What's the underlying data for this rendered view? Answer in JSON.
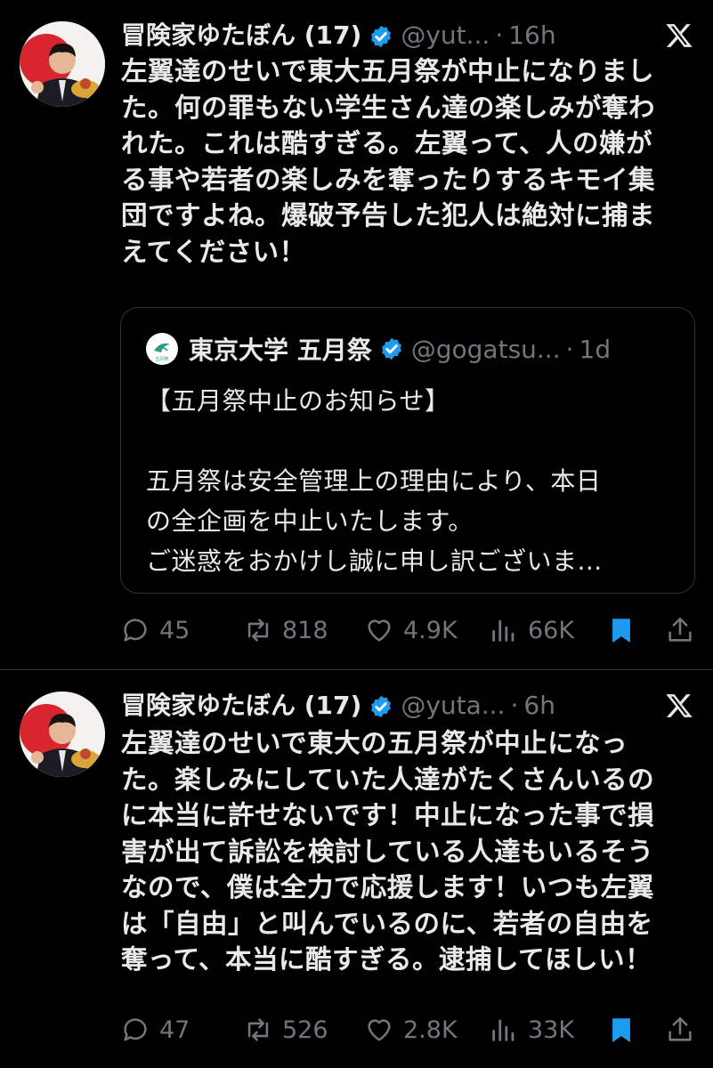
{
  "tweets": [
    {
      "author_name": "冒険家ゆたぼん (17)",
      "handle": "@yut...",
      "time": "16h",
      "text": "左翼達のせいで東大五月祭が中止になりまし\nた。何の罪もない学生さん達の楽しみが奪わ\nれた。これは酷すぎる。左翼って、人の嫌が\nる事や若者の楽しみを奪ったりするキモイ集\n団ですよね。爆破予告した犯人は絶対に捕ま\nえてください！",
      "quote": {
        "author_name": "東京大学 五月祭",
        "handle": "@gogatsu...",
        "time": "1d",
        "logo_text": "五月祭",
        "text": "【五月祭中止のお知らせ】\n\n五月祭は安全管理上の理由により、本日\nの全企画を中止いたします。\nご迷惑をおかけし誠に申し訳ございま..."
      },
      "replies": "45",
      "reposts": "818",
      "likes": "4.9K",
      "views": "66K"
    },
    {
      "author_name": "冒険家ゆたぼん (17)",
      "handle": "@yuta...",
      "time": "6h",
      "text": "左翼達のせいで東大の五月祭が中止になっ\nた。楽しみにしていた人達がたくさんいるの\nに本当に許せないです！中止になった事で損\n害が出て訴訟を検討している人達もいるそう\nなので、僕は全力で応援します！いつも左翼\nは「自由」と叫んでいるのに、若者の自由を\n奪って、本当に酷すぎる。逮捕してほしい！",
      "replies": "47",
      "reposts": "526",
      "likes": "2.8K",
      "views": "33K"
    }
  ],
  "colors": {
    "background": "#000000",
    "text": "#e7e9ea",
    "muted": "#71767b",
    "verified": "#1d9bf0",
    "bookmark": "#1d9bf0",
    "divider": "#2f3336"
  },
  "icons": {
    "verified": "verified-badge-icon",
    "x_logo": "x-logo-icon",
    "reply": "reply-icon",
    "repost": "repost-icon",
    "like": "heart-icon",
    "views": "views-icon",
    "bookmark": "bookmark-icon",
    "share": "share-icon"
  }
}
